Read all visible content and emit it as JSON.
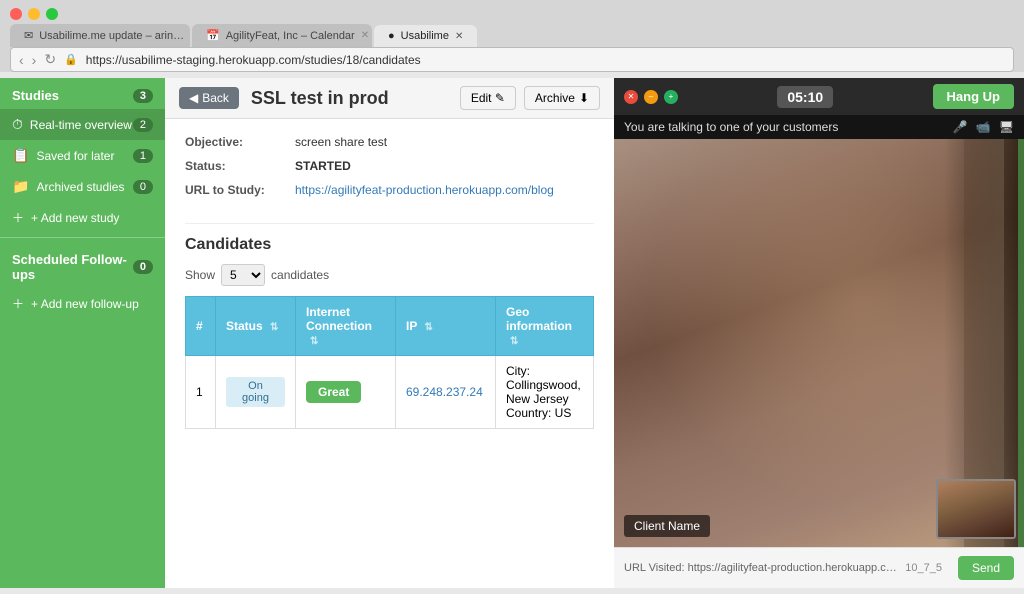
{
  "browser": {
    "tabs": [
      {
        "id": "tab1",
        "label": "Usabilime.me update – arin…",
        "favicon": "✉",
        "active": false,
        "closable": true
      },
      {
        "id": "tab2",
        "label": "AgilityFeat, Inc – Calendar",
        "favicon": "📅",
        "active": false,
        "closable": true
      },
      {
        "id": "tab3",
        "label": "Usabilime",
        "favicon": "🔵",
        "active": true,
        "closable": true
      }
    ],
    "address": "https://usabilime-staging.herokuapp.com/studies/18/candidates",
    "nav": {
      "back": "‹",
      "forward": "›",
      "reload": "↻"
    }
  },
  "sidebar": {
    "studies_label": "Studies",
    "studies_badge": "3",
    "items": [
      {
        "id": "realtime",
        "label": "Real-time overview",
        "badge": "2",
        "icon": "⏱",
        "active": true
      },
      {
        "id": "saved",
        "label": "Saved for later",
        "badge": "1",
        "icon": "📋",
        "active": false
      },
      {
        "id": "archived",
        "label": "Archived studies",
        "badge": "0",
        "icon": "📁",
        "active": false
      }
    ],
    "add_study_label": "+ Add new study",
    "scheduled_label": "Scheduled Follow-ups",
    "scheduled_badge": "0",
    "add_followup_label": "+ Add new follow-up"
  },
  "study": {
    "back_label": "Back",
    "title": "SSL test in prod",
    "edit_label": "Edit",
    "edit_icon": "✎",
    "archive_label": "Archive",
    "archive_icon": "⬇",
    "objective_label": "Objective:",
    "objective_value": "screen share test",
    "status_label": "Status:",
    "status_value": "STARTED",
    "url_label": "URL to Study:",
    "url_value": "https://agilityfeat-production.herokuapp.com/blog"
  },
  "candidates": {
    "section_title": "Candidates",
    "show_label": "Show",
    "show_value": "5",
    "candidates_label": "candidates",
    "table": {
      "headers": [
        {
          "id": "num",
          "label": "#"
        },
        {
          "id": "status",
          "label": "Status",
          "sortable": true
        },
        {
          "id": "connection",
          "label": "Internet Connection",
          "sortable": true
        },
        {
          "id": "ip",
          "label": "IP",
          "sortable": true
        },
        {
          "id": "geo",
          "label": "Geo information",
          "sortable": true
        }
      ],
      "rows": [
        {
          "num": "1",
          "status": "On going",
          "connection": "Great",
          "ip": "69.248.237.24",
          "geo_city": "City: Collingswood, New Jersey",
          "geo_country": "Country: US"
        }
      ]
    }
  },
  "video": {
    "timer": "05:10",
    "hangup_label": "Hang Up",
    "status_message": "You are talking to one of your customers",
    "client_name": "Client Name",
    "mic_icon": "🎤",
    "cam_icon": "📹",
    "screen_icon": "🖥",
    "url_visited_label": "URL Visited: https://agilityfeat-production.herokuapp.com/blog",
    "timestamp": "10_7_5",
    "send_label": "Send"
  }
}
